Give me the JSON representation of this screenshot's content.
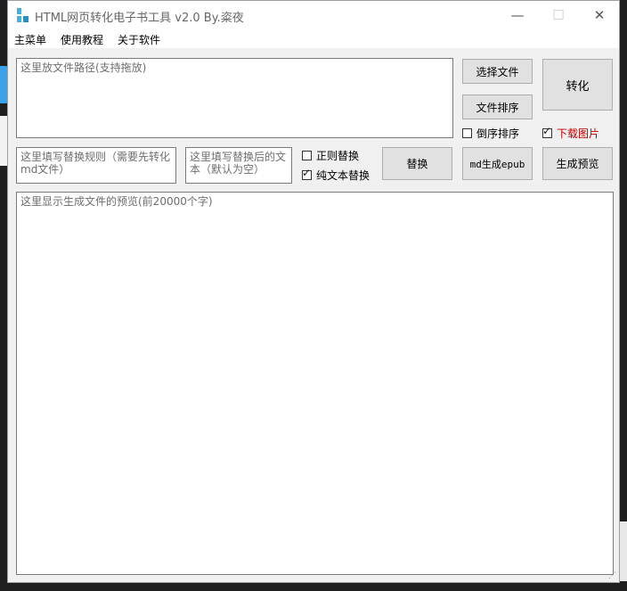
{
  "window": {
    "title": "HTML网页转化电子书工具 v2.0 By.粢夜",
    "controls": {
      "minimize": "—",
      "maximize": "☐",
      "close": "✕"
    }
  },
  "menu": [
    "主菜单",
    "使用教程",
    "关于软件"
  ],
  "file_path_input": {
    "placeholder": "这里放文件路径(支持拖放)"
  },
  "buttons": {
    "select_file": "选择文件",
    "sort_files": "文件排序",
    "convert": "转化",
    "replace": "替换",
    "md_to_epub": "md生成epub",
    "generate_preview": "生成预览"
  },
  "checkboxes": {
    "reverse_sort": {
      "label": "倒序排序",
      "checked": false
    },
    "download_images": {
      "label": "下载图片",
      "checked": true
    },
    "regex_replace": {
      "label": "正则替换",
      "checked": false
    },
    "plain_text_replace": {
      "label": "纯文本替换",
      "checked": true
    }
  },
  "replace_rule_input": {
    "placeholder": "这里填写替换规则（需要先转化md文件）"
  },
  "replace_with_input": {
    "placeholder": "这里填写替换后的文本（默认为空）"
  },
  "preview_area": {
    "placeholder": "这里显示生成文件的预览(前20000个字)"
  },
  "colors": {
    "download_images_label": "#c00000"
  }
}
